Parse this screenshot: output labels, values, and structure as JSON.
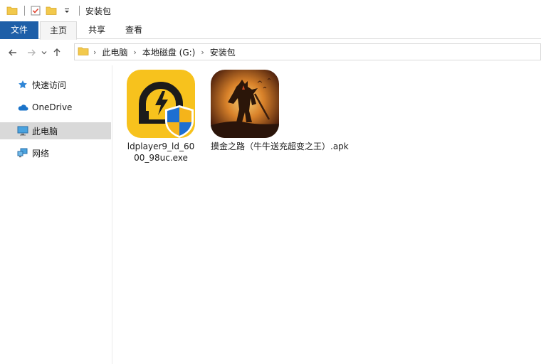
{
  "window": {
    "title": "安装包"
  },
  "quick_access_toolbar": {
    "icons": [
      "folder-icon",
      "properties-check-icon",
      "new-folder-icon",
      "customize-dropdown-icon"
    ]
  },
  "ribbon": {
    "tabs": [
      {
        "label": "文件",
        "active": false,
        "highlight": true
      },
      {
        "label": "主页",
        "active": true
      },
      {
        "label": "共享",
        "active": false
      },
      {
        "label": "查看",
        "active": false
      }
    ]
  },
  "nav": {
    "back": "back-arrow-icon",
    "forward": "forward-arrow-icon",
    "recent": "recent-dropdown-icon",
    "up": "up-arrow-icon"
  },
  "address": {
    "crumbs": [
      "此电脑",
      "本地磁盘 (G:)",
      "安装包"
    ]
  },
  "sidebar": {
    "items": [
      {
        "label": "快速访问",
        "icon": "star-icon",
        "selected": false
      },
      {
        "label": "OneDrive",
        "icon": "cloud-icon",
        "selected": false
      },
      {
        "label": "此电脑",
        "icon": "computer-icon",
        "selected": true
      },
      {
        "label": "网络",
        "icon": "network-icon",
        "selected": false
      }
    ]
  },
  "files": [
    {
      "name": "ldplayer9_ld_6000_98uc.exe",
      "icon": "ldplayer-shield-icon"
    },
    {
      "name": "摸金之路（牛牛送充超变之王）.apk",
      "icon": "game-warrior-icon"
    }
  ],
  "colors": {
    "file_tab": "#1e5fa8",
    "ldplayer_yellow": "#f7c21d",
    "selection": "#d9d9d9",
    "folder": "#f2c94c"
  }
}
